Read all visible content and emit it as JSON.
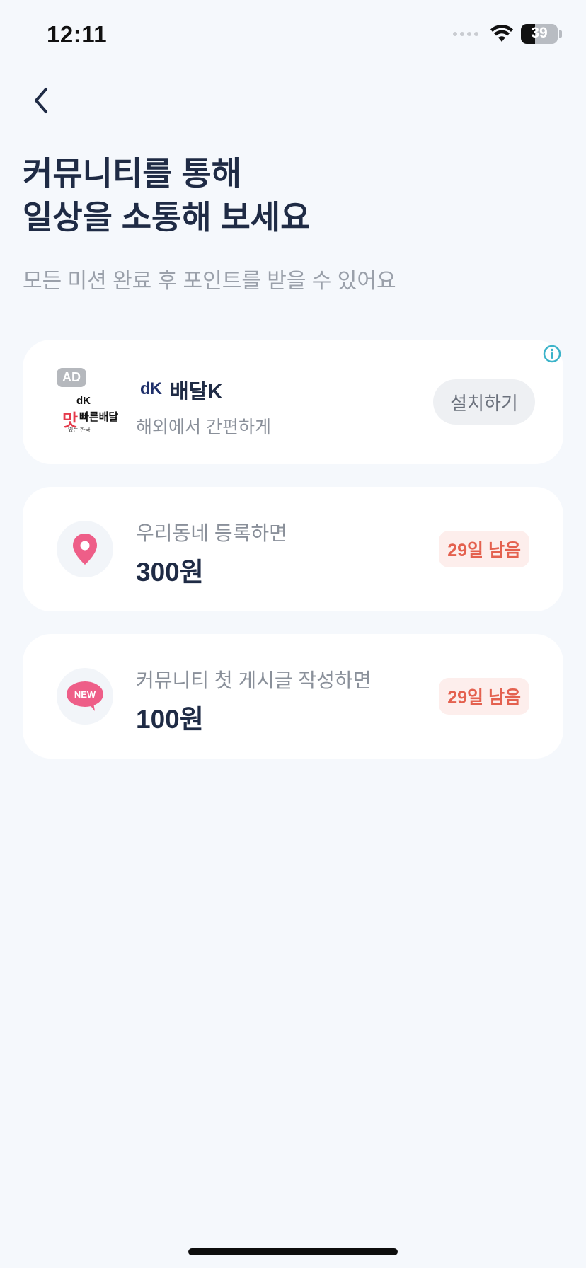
{
  "status_bar": {
    "time": "12:11",
    "battery_level": "39",
    "battery_fraction": 0.39
  },
  "header": {
    "back_icon": "chevron-left-icon",
    "title_line1": "커뮤니티를 통해",
    "title_line2": "일상을 소통해 보세요",
    "subtitle": "모든 미션 완료 후 포인트를 받을 수 있어요"
  },
  "ad_card": {
    "badge": "AD",
    "thumb_line1": "dK",
    "thumb_line2": "빠른배달",
    "thumb_line3": "맛",
    "thumb_line4": "있는 한국",
    "brand_logo": "dK",
    "title": "배달K",
    "description": "해외에서 간편하게",
    "install_label": "설치하기",
    "info_icon": "info-icon"
  },
  "missions": [
    {
      "icon": "location-pin-icon",
      "label": "우리동네 등록하면",
      "amount": "300원",
      "badge": "29일 남음"
    },
    {
      "icon": "new-speech-bubble-icon",
      "label": "커뮤니티 첫 게시글 작성하면",
      "amount": "100원",
      "badge": "29일 남음",
      "icon_text": "NEW"
    }
  ],
  "colors": {
    "background": "#f5f8fc",
    "card": "#ffffff",
    "title": "#1f2b45",
    "muted": "#8a909a",
    "badge_bg": "#fdeeec",
    "badge_text": "#e4614f",
    "pin": "#ee5e88"
  }
}
